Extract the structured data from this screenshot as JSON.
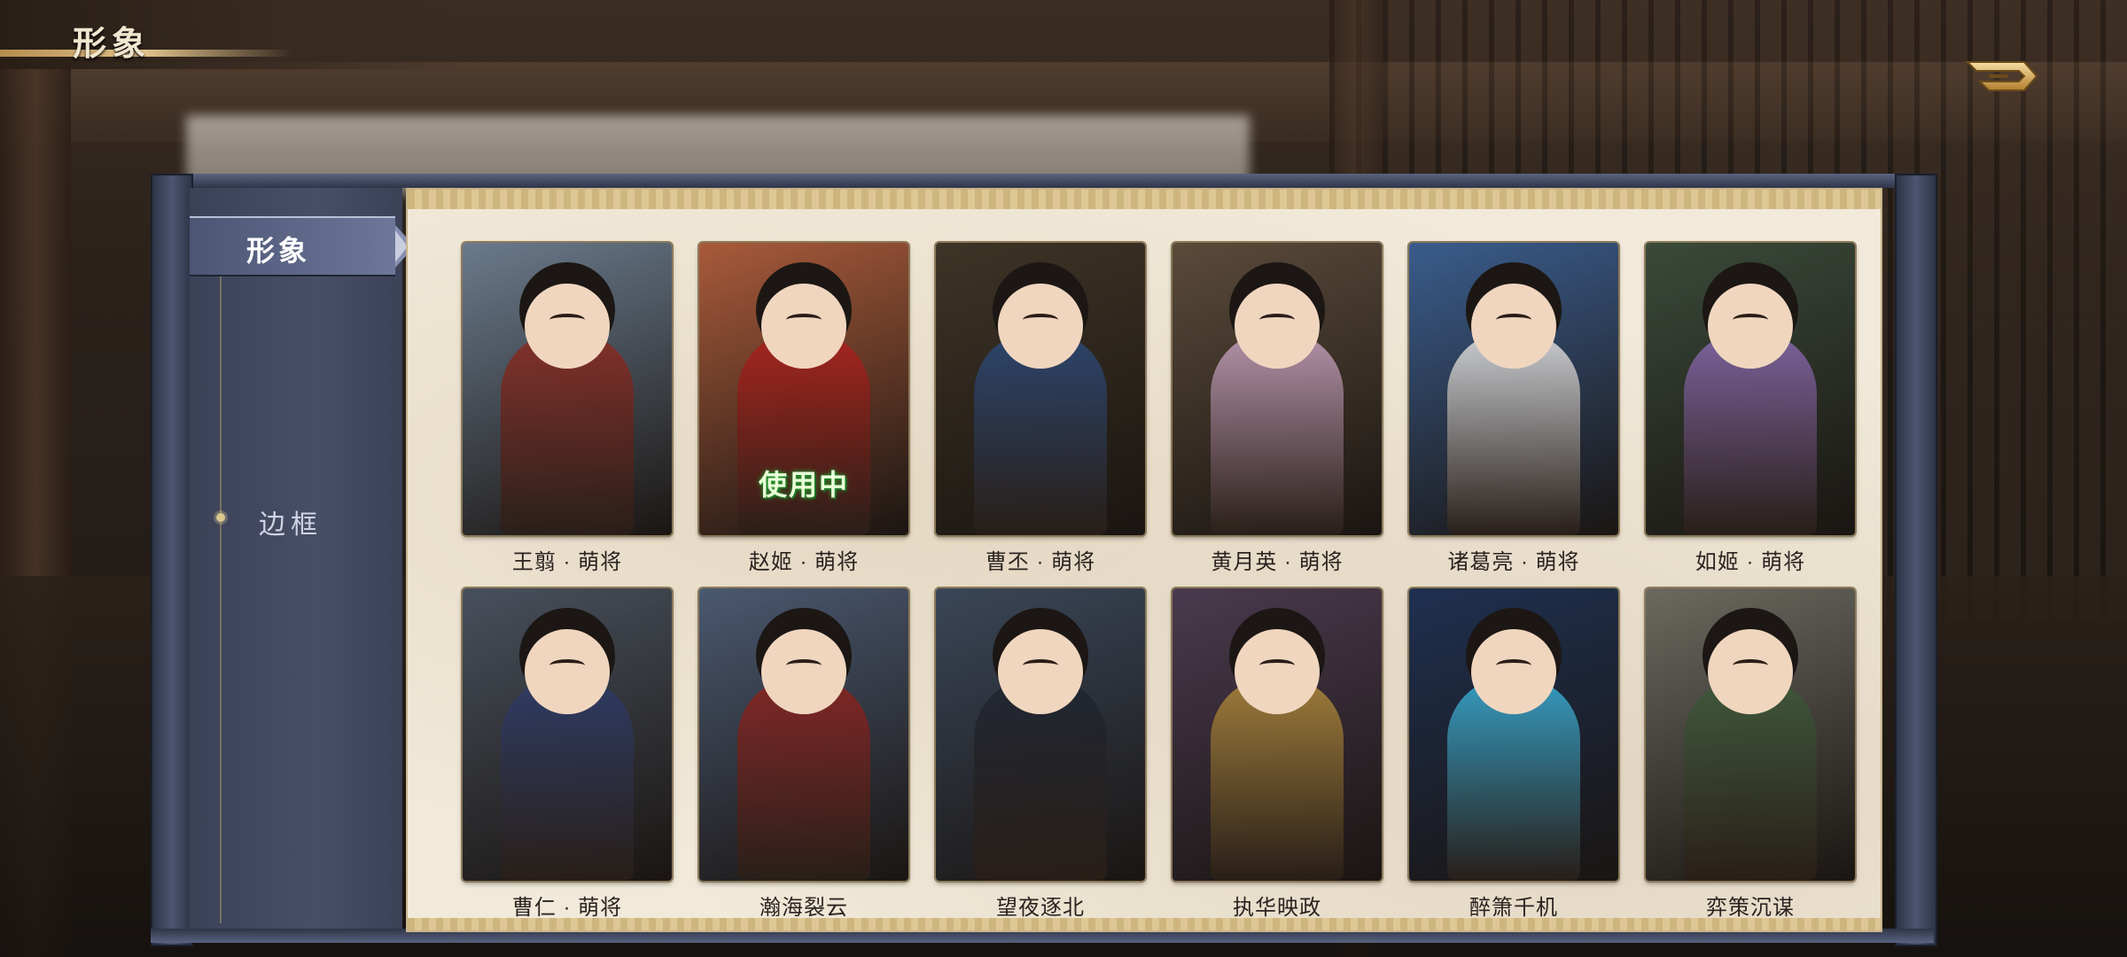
{
  "header": {
    "title": "形象",
    "back_label": "back"
  },
  "sidebar": {
    "tabs": [
      {
        "label": "形象",
        "active": true
      },
      {
        "label": "边框",
        "active": false
      }
    ]
  },
  "cards": [
    {
      "label": "王翦 · 萌将",
      "in_use": false,
      "theme": [
        "#6a7a8c",
        "#8e2b22"
      ]
    },
    {
      "label": "赵姬 · 萌将",
      "in_use": true,
      "badge": "使用中",
      "theme": [
        "#a85a3a",
        "#b0201c"
      ]
    },
    {
      "label": "曹丕 · 萌将",
      "in_use": false,
      "theme": [
        "#3e3426",
        "#2c4a7a"
      ]
    },
    {
      "label": "黄月英 · 萌将",
      "in_use": false,
      "theme": [
        "#5a4a3a",
        "#c9a3c0"
      ]
    },
    {
      "label": "诸葛亮 · 萌将",
      "in_use": false,
      "theme": [
        "#3a5c8c",
        "#e6e6e6"
      ]
    },
    {
      "label": "如姬 · 萌将",
      "in_use": false,
      "theme": [
        "#3a4a3a",
        "#8a6ab0"
      ]
    },
    {
      "label": "曹仁 · 萌将",
      "in_use": false,
      "theme": [
        "#48505c",
        "#2e3c6a"
      ]
    },
    {
      "label": "瀚海裂云",
      "in_use": false,
      "theme": [
        "#4a5870",
        "#8e2420"
      ]
    },
    {
      "label": "望夜逐北",
      "in_use": false,
      "theme": [
        "#3a4658",
        "#1f2530"
      ]
    },
    {
      "label": "执华映政",
      "in_use": false,
      "theme": [
        "#4a3a4e",
        "#b08a3c"
      ]
    },
    {
      "label": "醉箫千机",
      "in_use": false,
      "theme": [
        "#1e3050",
        "#3ab0d8"
      ]
    },
    {
      "label": "弈策沉谋",
      "in_use": false,
      "theme": [
        "#6a6a60",
        "#3e5a3a"
      ]
    }
  ],
  "colors": {
    "accent": "#c5a868",
    "panel": "#f1e9d9",
    "sidebar": "#474e66",
    "badge_glow": "#2ea83a"
  },
  "icons": {
    "back": "back-arrow-icon",
    "tab_dot": "diamond-bullet-icon"
  }
}
